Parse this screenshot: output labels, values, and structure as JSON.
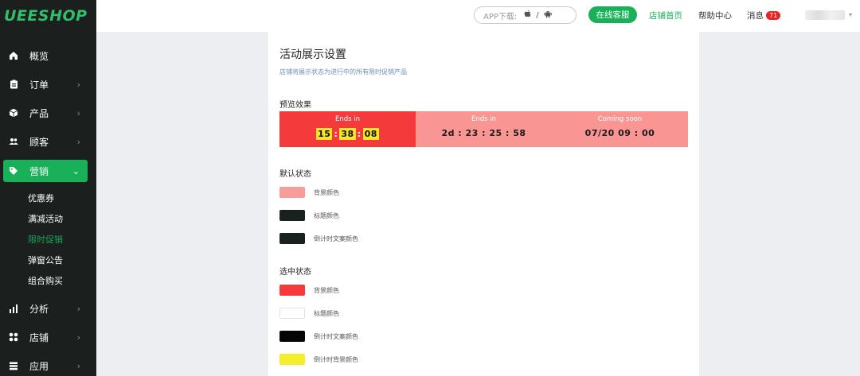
{
  "brand": {
    "logo": "UEESHOP"
  },
  "sidebar": {
    "items": [
      {
        "label": "概览",
        "icon": "home-icon"
      },
      {
        "label": "订单",
        "icon": "clipboard-icon"
      },
      {
        "label": "产品",
        "icon": "box-icon"
      },
      {
        "label": "顾客",
        "icon": "users-icon"
      },
      {
        "label": "营销",
        "icon": "tag-icon"
      },
      {
        "label": "分析",
        "icon": "bar-chart-icon"
      },
      {
        "label": "店铺",
        "icon": "grid-icon"
      },
      {
        "label": "应用",
        "icon": "apps-icon"
      }
    ],
    "sub_items": [
      "优惠券",
      "满减活动",
      "限时促销",
      "弹窗公告",
      "组合购买"
    ]
  },
  "header": {
    "app_download": "APP下载:",
    "slash": "/",
    "online_service": "在线客服",
    "store_home": "店铺首页",
    "help_center": "帮助中心",
    "messages": "消息",
    "message_count": "71",
    "dropdown": "▾"
  },
  "main": {
    "title": "活动展示设置",
    "description": "店铺将展示状态为进行中的所有限时促销产品",
    "preview_label": "预览效果",
    "preview": [
      {
        "label": "Ends in",
        "h": "15",
        "m": "38",
        "s": "08",
        "sep": ":"
      },
      {
        "label": "Ends in",
        "value": "2d : 23 : 25 : 58"
      },
      {
        "label": "Coming soon",
        "value": "07/20  09 : 00"
      }
    ],
    "default_state": {
      "label": "默认状态",
      "swatches": [
        {
          "label": "背景颜色",
          "color": "#f99c99"
        },
        {
          "label": "标题颜色",
          "color": "#18211d"
        },
        {
          "label": "倒计时文案颜色",
          "color": "#18211d"
        }
      ]
    },
    "selected_state": {
      "label": "选中状态",
      "swatches": [
        {
          "label": "背景颜色",
          "color": "#f43a3a"
        },
        {
          "label": "标题颜色",
          "color": "#ffffff"
        },
        {
          "label": "倒计时文案颜色",
          "color": "#050505"
        },
        {
          "label": "倒计时背景颜色",
          "color": "#f5ee2a"
        }
      ]
    }
  },
  "colors": {
    "accent": "#18b15a",
    "sidebar_bg": "#1b1f1d",
    "badge": "#e8241f"
  }
}
